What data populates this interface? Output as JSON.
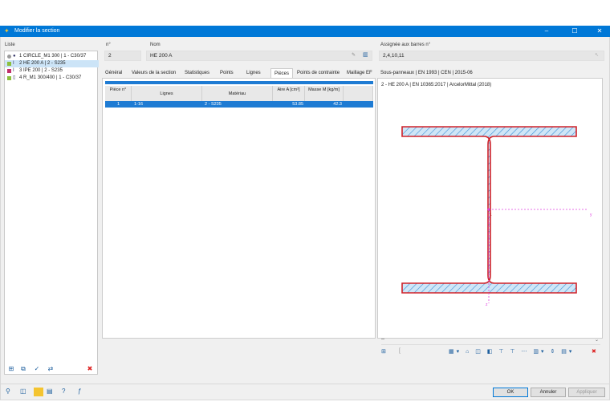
{
  "window": {
    "title": "Modifier la section"
  },
  "list": {
    "label": "Liste",
    "items": [
      {
        "num": "1",
        "label": "CIRCLE_M1 300 | 1 - C30/37",
        "color": "#9a9a9a"
      },
      {
        "num": "2",
        "label": "HE 200 A | 2 - S235",
        "color": "#8bbf3c"
      },
      {
        "num": "3",
        "label": "IPE 200 | 2 - S235",
        "color": "#c0306a"
      },
      {
        "num": "4",
        "label": "R_M1 300/400 | 1 - C30/37",
        "color": "#8bbf3c"
      }
    ]
  },
  "fields": {
    "no_label": "n°",
    "no_value": "2",
    "name_label": "Nom",
    "name_value": "HE 200 A",
    "assigned_label": "Assignée aux barres n°",
    "assigned_value": "2,4,10,11"
  },
  "tabs": [
    "Général",
    "Valeurs de la section",
    "Statistiques",
    "Points",
    "Lignes",
    "Pièces",
    "Points de contrainte",
    "Maillage EF",
    "Sous-panneaux | EN 1993 | CEN | 2015-06"
  ],
  "table": {
    "headers": {
      "piece": "Pièce n°",
      "lines": "Lignes",
      "material": "Matériau",
      "area": "Aire A [cm²]",
      "mass": "Masse M [kg/m]"
    },
    "rows": [
      {
        "piece": "1",
        "lines": "1-16",
        "material": "2 - S235",
        "area": "53.85",
        "mass": "42.3"
      }
    ]
  },
  "preview": {
    "caption": "2 - HE 200 A | EN 10365:2017 | ArcelorMittal (2018)",
    "dropdown": "--",
    "axis_y": "y",
    "axis_z": "z",
    "node": "1"
  },
  "buttons": {
    "ok": "OK",
    "cancel": "Annuler",
    "apply": "Appliquer"
  }
}
